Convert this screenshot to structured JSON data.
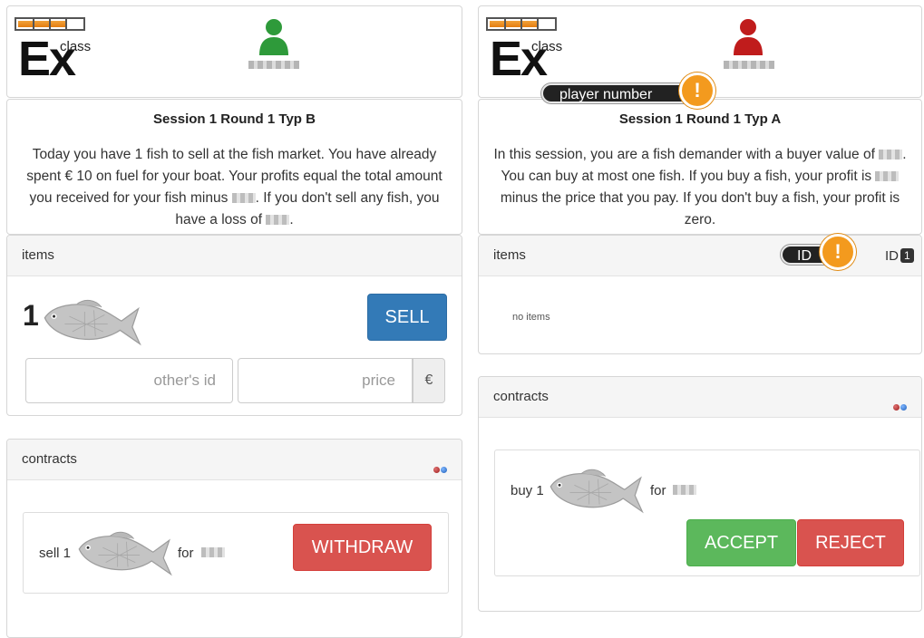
{
  "logo": {
    "text_main": "Ex",
    "text_sub": "class"
  },
  "left": {
    "info": {
      "title": "Session 1 Round 1 Typ B",
      "text_1": "Today you have 1 fish to sell at the fish market. You have already spent € 10 on fuel for your boat. Your profits equal the total amount you received for your fish minus ",
      "text_2": ". If you don't sell any fish, you have a loss of ",
      "text_3": "."
    },
    "items": {
      "heading": "items",
      "count": "1",
      "sell_label": "SELL",
      "others_id_placeholder": "other's id",
      "price_placeholder": "price",
      "currency": "€"
    },
    "contracts": {
      "heading": "contracts",
      "text": "sell 1",
      "for_label": "for",
      "withdraw_label": "WITHDRAW"
    }
  },
  "right": {
    "tooltip_player": "player number",
    "info": {
      "title": "Session 1 Round 1 Typ A",
      "text_1": "In this session, you are a fish demander with a buyer value of ",
      "text_2": ". You can buy at most one fish. If you buy a fish, your profit is ",
      "text_3": " minus the price that you pay. If you don't buy a fish, your profit is zero."
    },
    "items": {
      "heading": "items",
      "tooltip_id": "ID",
      "id_label": "ID",
      "id_value": "1",
      "empty_text": "no items"
    },
    "contracts": {
      "heading": "contracts",
      "text": "buy 1",
      "for_label": "for",
      "accept_label": "ACCEPT",
      "reject_label": "REJECT"
    }
  },
  "icons": {
    "warning": "!",
    "player_left": "user-icon-green",
    "player_right": "user-icon-red",
    "fish": "fish-icon"
  },
  "colors": {
    "player_left": "#2e9a3a",
    "player_right": "#c01c1c",
    "meter": "#e8891a"
  }
}
